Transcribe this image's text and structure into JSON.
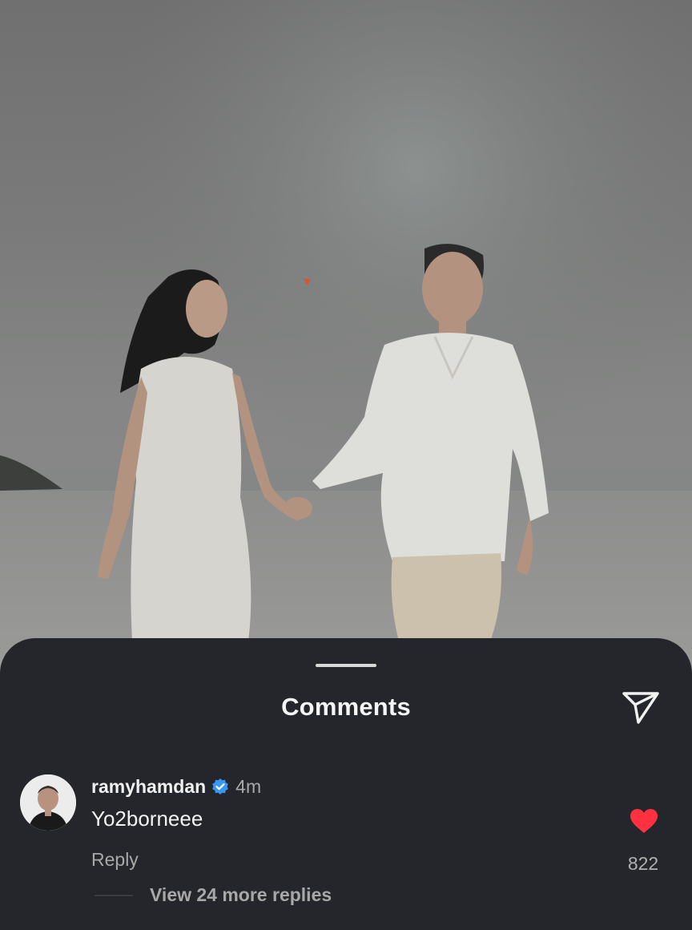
{
  "post": {
    "image": "photo-couple-walking-on-beach"
  },
  "comments_sheet": {
    "title": "Comments",
    "share_icon": "paper-plane-icon",
    "comment": {
      "username": "ramyhamdan",
      "verified_icon": "verified-badge-icon",
      "time": "4m",
      "text": "Yo2borneee",
      "reply_label": "Reply",
      "like_icon": "heart-filled-icon",
      "like_count": "822",
      "view_replies_label": "View 24 more replies"
    }
  },
  "colors": {
    "sheet_background": "#25262b",
    "verified_blue": "#3897f0",
    "like_red": "#ff3040"
  }
}
